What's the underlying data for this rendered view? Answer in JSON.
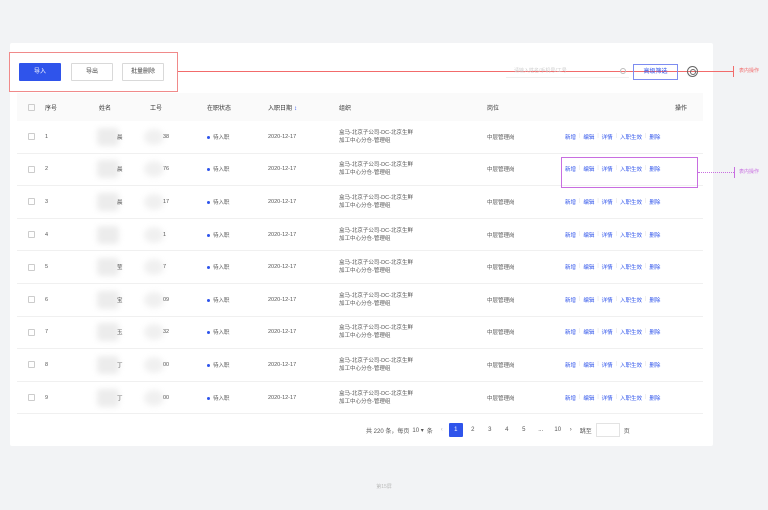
{
  "toolbar": {
    "import_label": "导入",
    "export_label": "导出",
    "batch_delete_label": "批量删除",
    "search_placeholder": "请输入姓名/手机号/工号",
    "advanced_filter_label": "高级筛选"
  },
  "annotations": {
    "table_actions_label": "表内操作",
    "row_actions_label": "表内操作"
  },
  "columns": {
    "index": "序号",
    "name": "姓名",
    "emp_no": "工号",
    "status": "在职状态",
    "join_date": "入职日期",
    "org": "组织",
    "position": "岗位",
    "actions": "操作"
  },
  "rows": [
    {
      "index": "1",
      "name": "晨",
      "emp_no": "38",
      "status": "待入职",
      "join_date": "2020-12-17",
      "org_line1": "盒马-北京子公司-DC-北京生鲜",
      "org_line2": "加工中心分仓-管理组",
      "position": "中层管理岗"
    },
    {
      "index": "2",
      "name": "晨",
      "emp_no": "76",
      "status": "待入职",
      "join_date": "2020-12-17",
      "org_line1": "盒马-北京子公司-DC-北京生鲜",
      "org_line2": "加工中心分仓-管理组",
      "position": "中层管理岗"
    },
    {
      "index": "3",
      "name": "晨",
      "emp_no": "17",
      "status": "待入职",
      "join_date": "2020-12-17",
      "org_line1": "盒马-北京子公司-DC-北京生鲜",
      "org_line2": "加工中心分仓-管理组",
      "position": "中层管理岗"
    },
    {
      "index": "4",
      "name": "",
      "emp_no": "1",
      "status": "待入职",
      "join_date": "2020-12-17",
      "org_line1": "盒马-北京子公司-DC-北京生鲜",
      "org_line2": "加工中心分仓-管理组",
      "position": "中层管理岗"
    },
    {
      "index": "5",
      "name": "莹",
      "emp_no": "7",
      "status": "待入职",
      "join_date": "2020-12-17",
      "org_line1": "盒马-北京子公司-DC-北京生鲜",
      "org_line2": "加工中心分仓-管理组",
      "position": "中层管理岗"
    },
    {
      "index": "6",
      "name": "宝",
      "emp_no": "09",
      "status": "待入职",
      "join_date": "2020-12-17",
      "org_line1": "盒马-北京子公司-DC-北京生鲜",
      "org_line2": "加工中心分仓-管理组",
      "position": "中层管理岗"
    },
    {
      "index": "7",
      "name": "玉",
      "emp_no": "32",
      "status": "待入职",
      "join_date": "2020-12-17",
      "org_line1": "盒马-北京子公司-DC-北京生鲜",
      "org_line2": "加工中心分仓-管理组",
      "position": "中层管理岗"
    },
    {
      "index": "8",
      "name": "丁",
      "emp_no": "00",
      "status": "待入职",
      "join_date": "2020-12-17",
      "org_line1": "盒马-北京子公司-DC-北京生鲜",
      "org_line2": "加工中心分仓-管理组",
      "position": "中层管理岗"
    },
    {
      "index": "9",
      "name": "丁",
      "emp_no": "00",
      "status": "待入职",
      "join_date": "2020-12-17",
      "org_line1": "盒马-北京子公司-DC-北京生鲜",
      "org_line2": "加工中心分仓-管理组",
      "position": "中层管理岗"
    }
  ],
  "row_actions": [
    "新增",
    "编辑",
    "详情",
    "入职生效",
    "删除"
  ],
  "pagination": {
    "total_text": "共 220 条，每页",
    "page_size": "10",
    "unit": "条",
    "pages": [
      "1",
      "2",
      "3",
      "4",
      "5",
      "...",
      "10"
    ],
    "jump_label": "跳至",
    "page_label": "页"
  },
  "footer": "第15屏"
}
